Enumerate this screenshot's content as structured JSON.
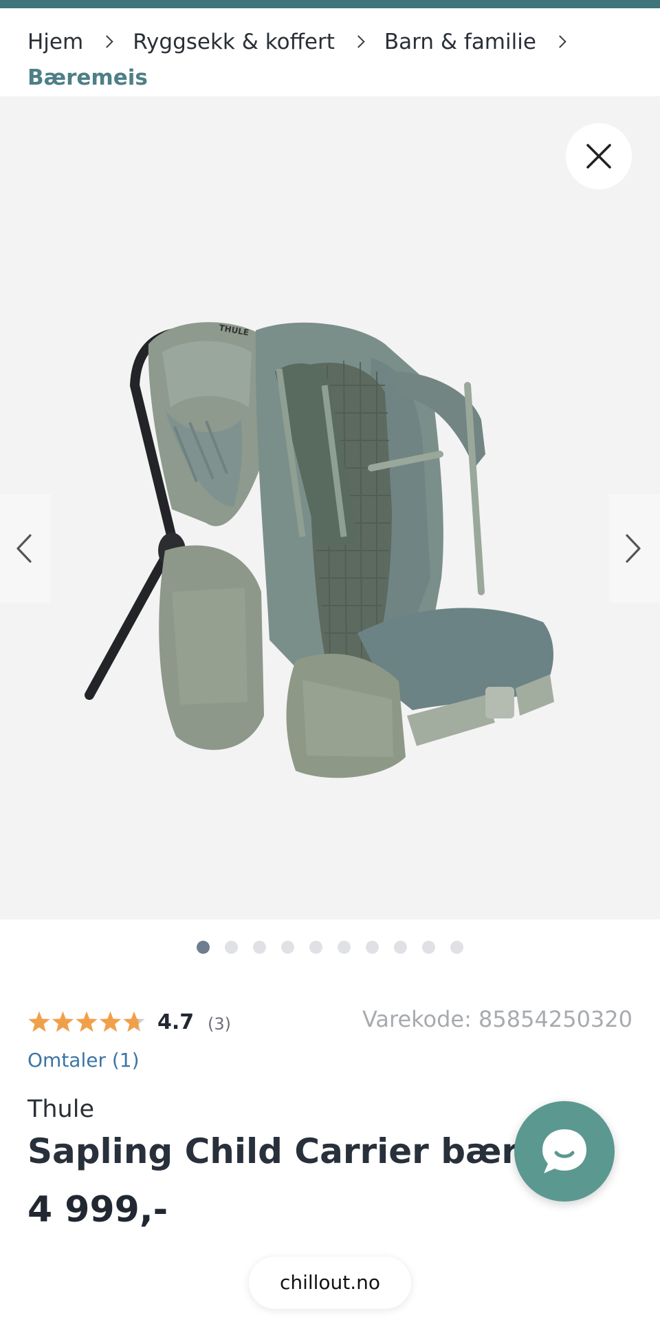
{
  "breadcrumb": {
    "items": [
      {
        "label": "Hjem"
      },
      {
        "label": "Ryggsekk & koffert"
      },
      {
        "label": "Barn & familie"
      }
    ],
    "current": "Bæremeis"
  },
  "gallery": {
    "image_alt": "Thule Sapling Child Carrier bæremeis",
    "image_count": 10,
    "active_index": 0,
    "brand_tag": "THULE"
  },
  "rating": {
    "value": "4.7",
    "score": 4.7,
    "max": 5,
    "count": "(3)"
  },
  "product": {
    "code": "Varekode: 85854250320",
    "reviews_link": "Omtaler (1)",
    "brand": "Thule",
    "name": "Sapling Child Carrier bæremeis",
    "price": "4 999,-"
  },
  "footer": {
    "domain": "chillout.no"
  },
  "colors": {
    "accent": "#3f7478",
    "breadcrumb_current": "#4d7f86",
    "star": "#f0a04b",
    "link": "#3b74a6",
    "chat": "#5b9890"
  },
  "icons": {
    "close": "close-icon",
    "prev": "chevron-left-icon",
    "next": "chevron-right-icon",
    "chat": "chat-icon",
    "star": "star-icon"
  }
}
